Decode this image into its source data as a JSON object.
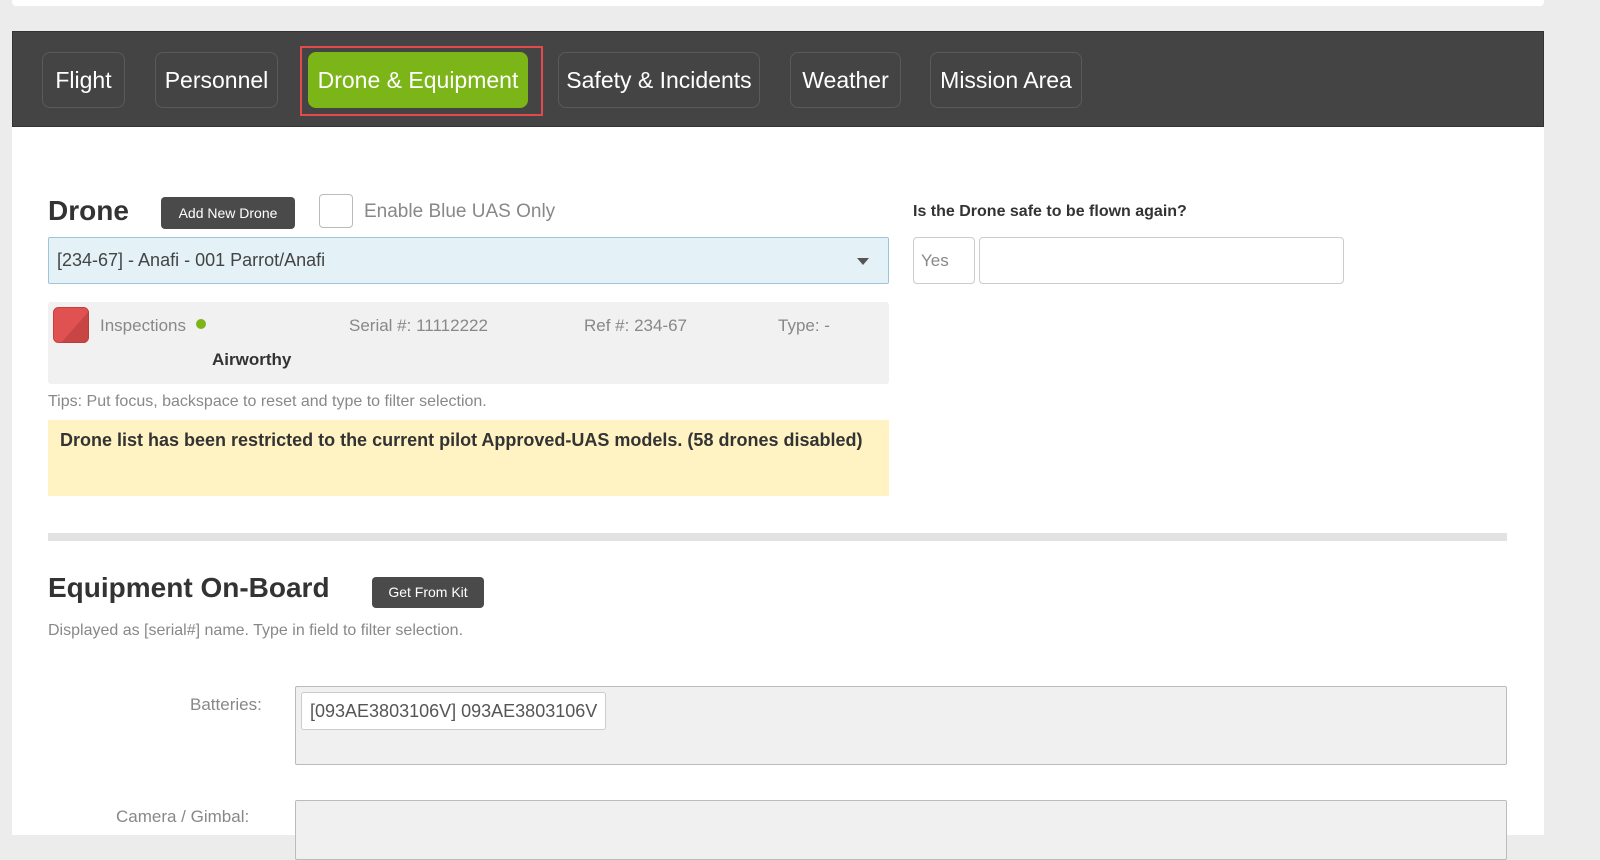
{
  "tabs": [
    {
      "label": "Flight",
      "active": false
    },
    {
      "label": "Personnel",
      "active": false
    },
    {
      "label": "Drone & Equipment",
      "active": true
    },
    {
      "label": "Safety & Incidents",
      "active": false
    },
    {
      "label": "Weather",
      "active": false
    },
    {
      "label": "Mission Area",
      "active": false
    }
  ],
  "drone": {
    "heading": "Drone",
    "add_button": "Add New Drone",
    "blue_uas_label": "Enable Blue UAS Only",
    "blue_uas_checked": false,
    "selected": "[234-67] - Anafi - 001 Parrot/Anafi",
    "info": {
      "inspections_label": "Inspections",
      "status": "Airworthy",
      "serial": "Serial #: 11112222",
      "ref": "Ref #: 234-67",
      "type": "Type: -"
    },
    "tips": "Tips: Put focus, backspace to reset and type to filter selection.",
    "warning": "Drone list has been restricted to the current pilot Approved-UAS models. (58 drones disabled)"
  },
  "safety_question": {
    "label": "Is the Drone safe to be flown again?",
    "answer": "Yes",
    "notes": ""
  },
  "equipment": {
    "heading": "Equipment On-Board",
    "kit_button": "Get From Kit",
    "hint": "Displayed as [serial#] name. Type in field to filter selection.",
    "batteries_label": "Batteries:",
    "batteries": [
      "[093AE3803106V] 093AE3803106V"
    ],
    "next_label": "Camera / Gimbal:"
  },
  "colors": {
    "active_tab": "#7cb518",
    "tab_bar": "#444444",
    "highlight": "#e14b4b",
    "warning_bg": "#fff3c4",
    "status_dot": "#7cb518",
    "status_icon": "#e05252"
  }
}
